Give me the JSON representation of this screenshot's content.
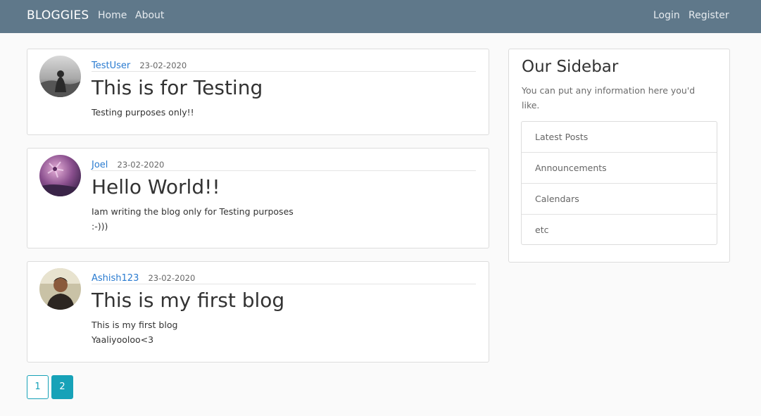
{
  "navbar": {
    "brand": "BLOGGIES",
    "links": [
      "Home",
      "About"
    ],
    "right_links": [
      "Login",
      "Register"
    ]
  },
  "posts": [
    {
      "author": "TestUser",
      "date": "23-02-2020",
      "title": "This is for Testing",
      "lines": [
        "Testing purposes only!!"
      ]
    },
    {
      "author": "Joel",
      "date": "23-02-2020",
      "title": "Hello World!!",
      "lines": [
        "Iam writing the blog only for Testing purposes",
        ":-)))"
      ]
    },
    {
      "author": "Ashish123",
      "date": "23-02-2020",
      "title": "This is my first blog",
      "lines": [
        "This is my first blog",
        "Yaaliyooloo<3"
      ]
    }
  ],
  "sidebar": {
    "title": "Our Sidebar",
    "description": "You can put any information here you'd like.",
    "items": [
      "Latest Posts",
      "Announcements",
      "Calendars",
      "etc"
    ]
  },
  "pagination": {
    "pages": [
      "1",
      "2"
    ],
    "current": "2"
  },
  "colors": {
    "navbar": "#5f788a",
    "link": "#2a7bd0",
    "accent": "#17a2b8"
  }
}
